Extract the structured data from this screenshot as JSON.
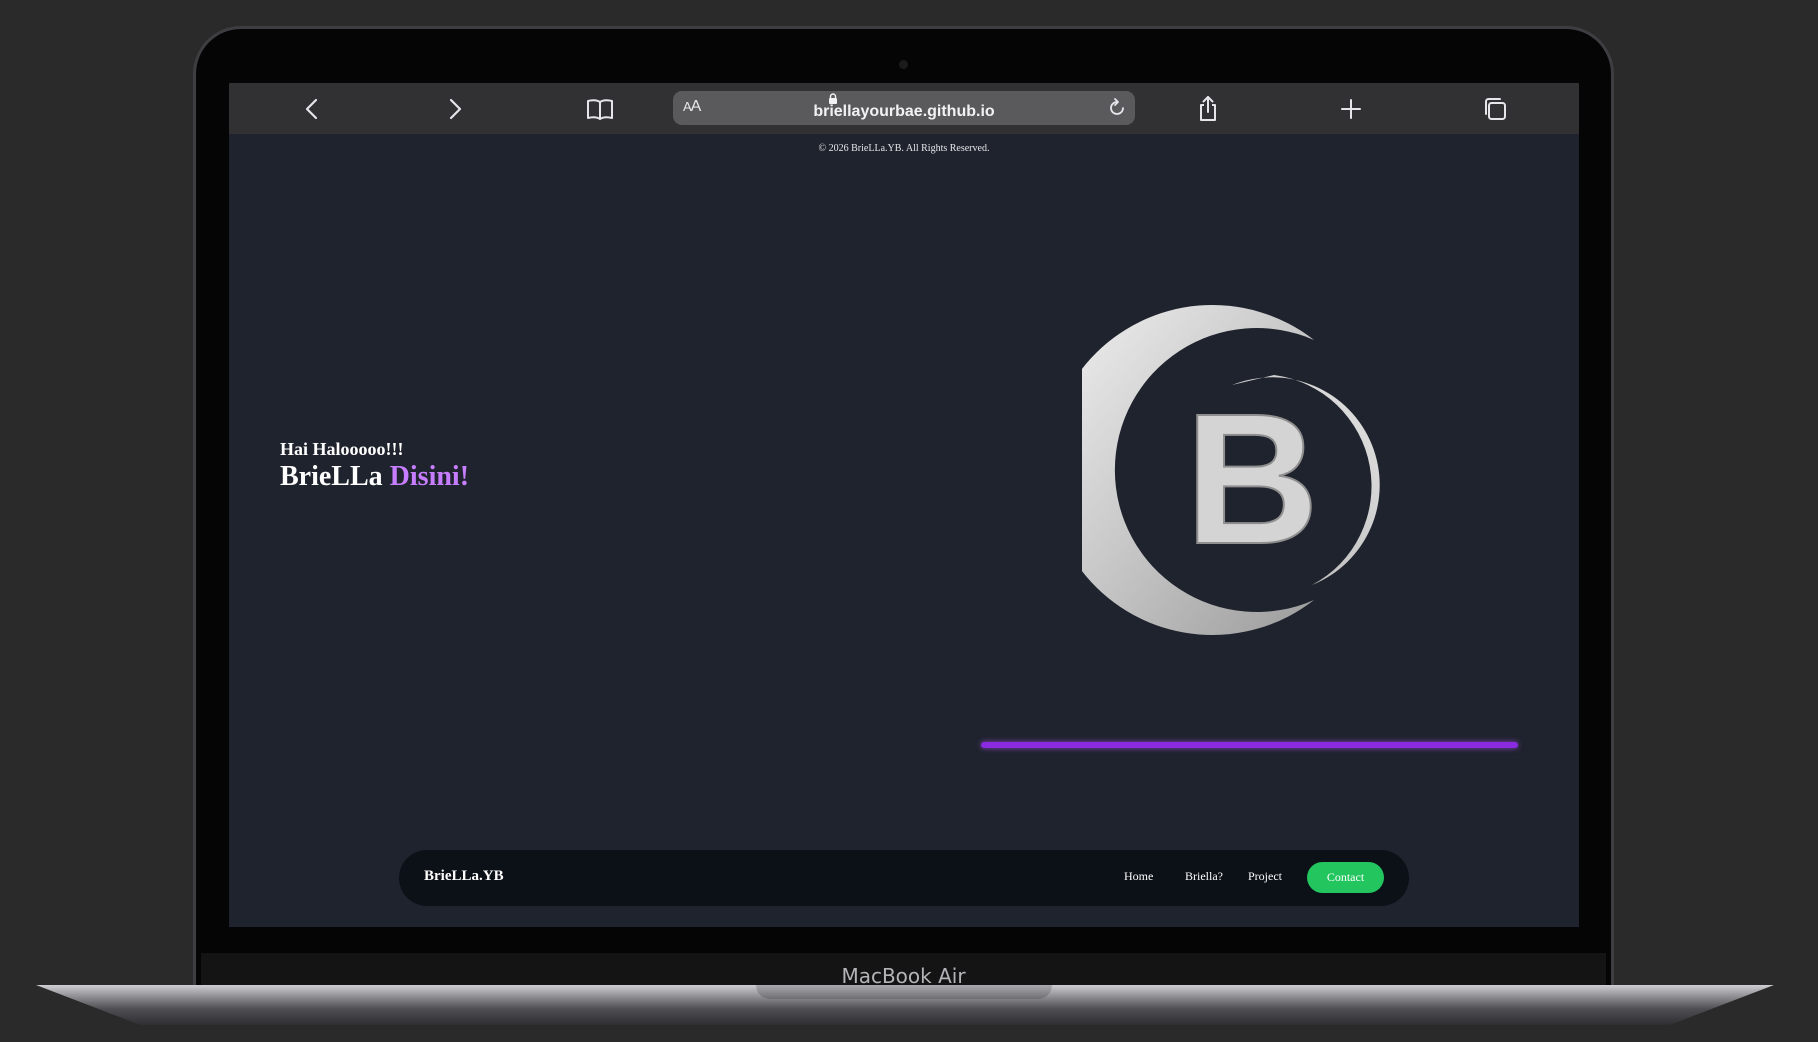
{
  "device": {
    "model_label": "MacBook Air"
  },
  "browser": {
    "text_size_label_big": "A",
    "text_size_label_small": "A",
    "url": "briellayourbae.github.io",
    "icons": [
      "back-icon",
      "forward-icon",
      "bookmarks-icon",
      "lock-icon",
      "reload-icon",
      "share-icon",
      "new-tab-icon",
      "tabs-icon"
    ]
  },
  "page": {
    "copyright": "© 2026 BrieLLa.YB. All Rights Reserved.",
    "hero": {
      "greeting": "Hai Halooooo!!!",
      "title_main": "BrieLLa",
      "title_accent": "Disini!"
    },
    "logo_letter": "B",
    "nav": {
      "brand": "BrieLLa.YB",
      "links": [
        "Home",
        "Briella?",
        "Project"
      ],
      "contact": "Contact"
    }
  },
  "colors": {
    "page_background": "#1f232d",
    "accent_purple": "#c77dff",
    "line_purple": "#8a2be2",
    "contact_green": "#22c55e",
    "navbar_background": "#0c1118"
  }
}
